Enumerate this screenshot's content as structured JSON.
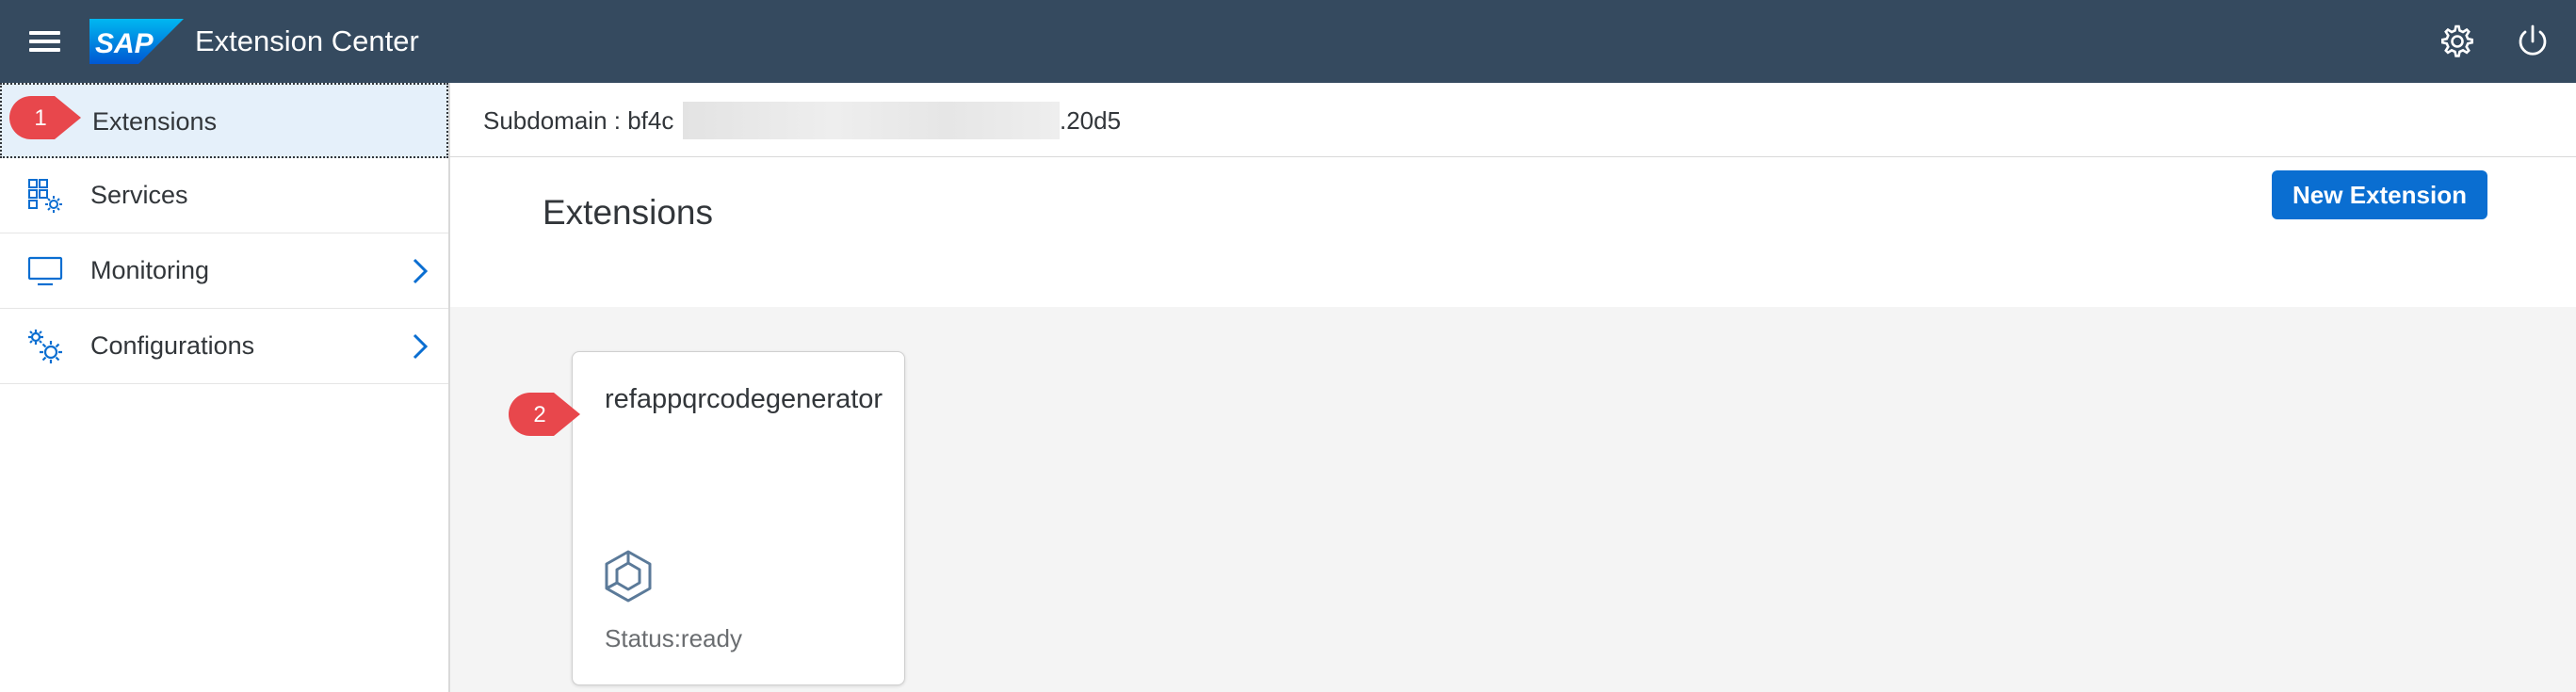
{
  "shellbar": {
    "title": "Extension Center",
    "logo_text": "SAP",
    "icons": [
      "menu-icon",
      "settings-icon",
      "power-icon"
    ]
  },
  "sidebar": {
    "items": [
      {
        "label": "Extensions",
        "icon": "puzzle-icon",
        "selected": true,
        "has_submenu": false
      },
      {
        "label": "Services",
        "icon": "services-grid-icon",
        "selected": false,
        "has_submenu": false
      },
      {
        "label": "Monitoring",
        "icon": "monitor-icon",
        "selected": false,
        "has_submenu": true
      },
      {
        "label": "Configurations",
        "icon": "gears-icon",
        "selected": false,
        "has_submenu": true
      }
    ]
  },
  "subdomain": {
    "label": "Subdomain : bf4c",
    "suffix": ".20d5"
  },
  "page": {
    "title": "Extensions",
    "new_button_label": "New Extension"
  },
  "tiles": [
    {
      "title": "refappqrcodegenerator",
      "status": "Status:ready",
      "icon": "cube-icon"
    }
  ],
  "callouts": [
    {
      "number": "1"
    },
    {
      "number": "2"
    }
  ],
  "colors": {
    "shellbar": "#354a5f",
    "accent": "#0a6ed1",
    "callout": "#e8474c",
    "selected_bg": "#e5f0fa",
    "content_bg": "#f4f4f4"
  }
}
